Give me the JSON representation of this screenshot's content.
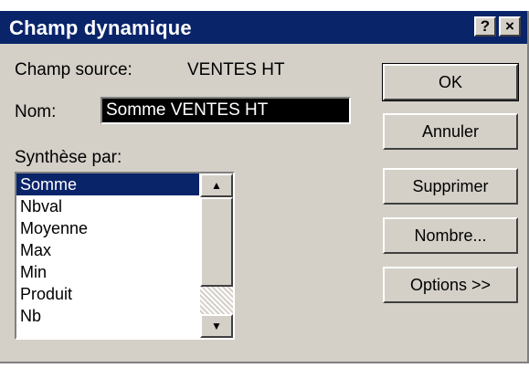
{
  "dialog": {
    "title": "Champ dynamique",
    "help_label": "?",
    "close_label": "×"
  },
  "source": {
    "label": "Champ source:",
    "value": "VENTES HT"
  },
  "name": {
    "label": "Nom:",
    "value": "Somme VENTES HT"
  },
  "summary": {
    "label": "Synthèse par:",
    "items": [
      "Somme",
      "Nbval",
      "Moyenne",
      "Max",
      "Min",
      "Produit",
      "Nb"
    ],
    "selected": "Somme"
  },
  "buttons": {
    "ok": "OK",
    "cancel": "Annuler",
    "delete": "Supprimer",
    "number": "Nombre...",
    "options": "Options >>"
  },
  "icons": {
    "scroll_up": "arrow-up-icon",
    "scroll_down": "arrow-down-icon"
  }
}
